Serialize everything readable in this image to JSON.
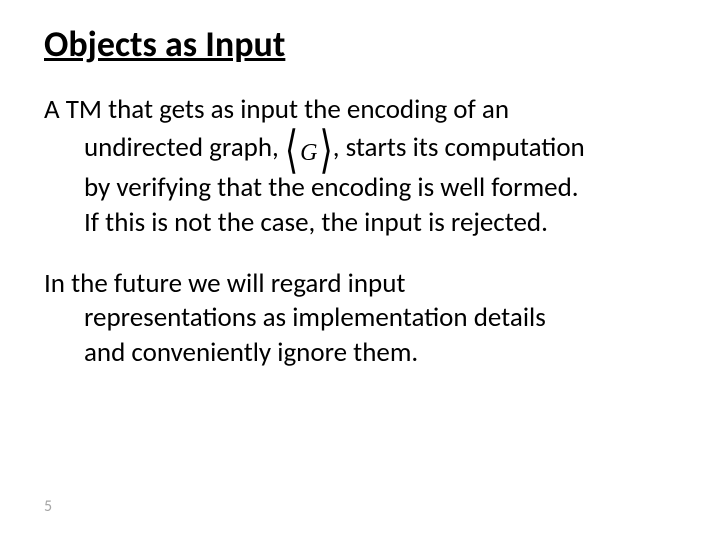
{
  "title": "Objects as Input",
  "para1": {
    "lead": "A TM that gets as input the encoding of an",
    "line2a": "undirected graph,",
    "encoding_var": "G",
    "line2b": ", starts its computation",
    "line3": "by verifying that the encoding is well formed.",
    "line4": "If this is not the case, the input is rejected."
  },
  "para2": {
    "lead": "In the future we will regard input",
    "line2": "representations as implementation details",
    "line3": "and conveniently ignore them."
  },
  "page_number": "5"
}
